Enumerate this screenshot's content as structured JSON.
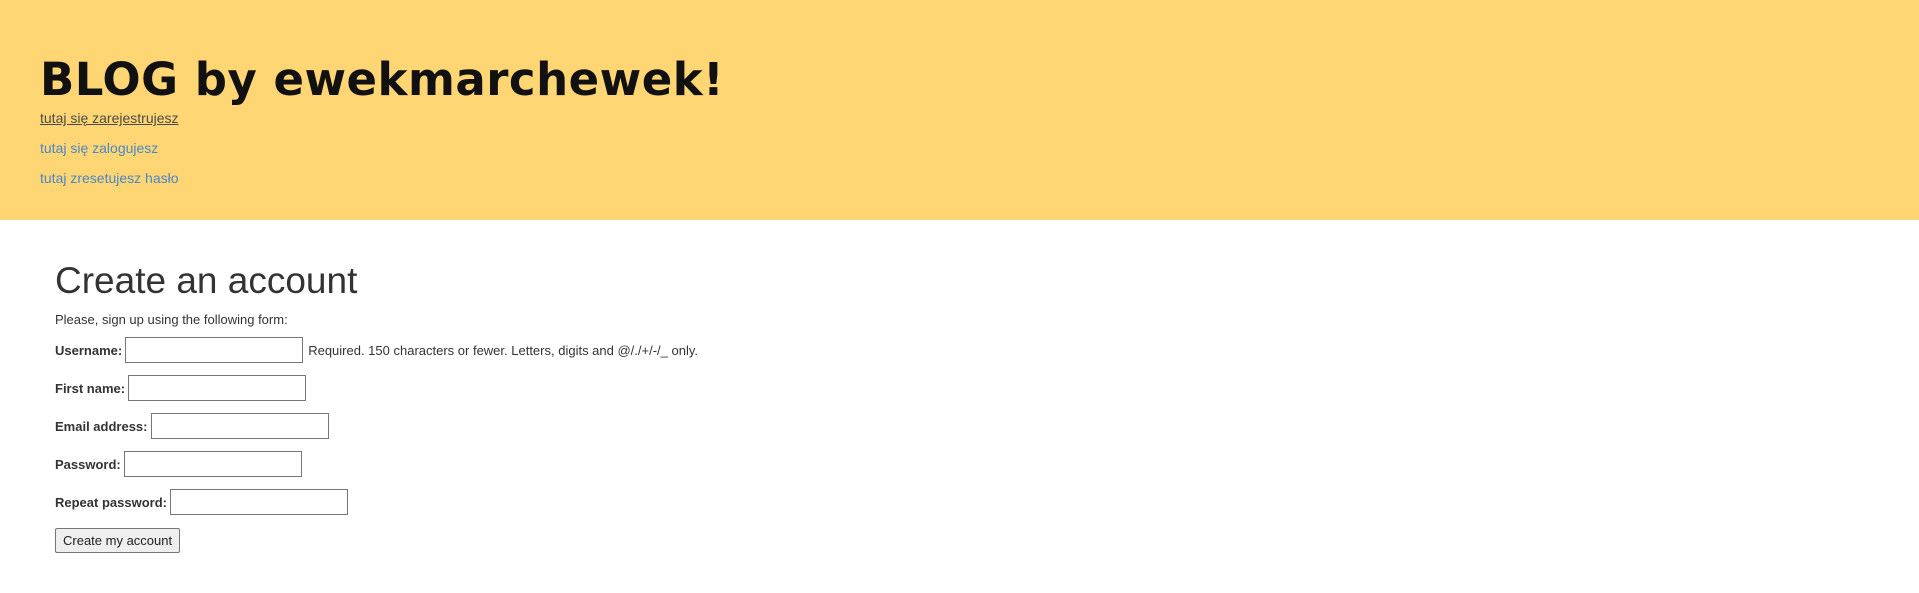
{
  "header": {
    "site_title": "BLOG by ewekmarchewek!",
    "nav": [
      {
        "label": "tutaj się zarejestrujesz"
      },
      {
        "label": "tutaj się zalogujesz"
      },
      {
        "label": "tutaj zresetujesz hasło"
      }
    ]
  },
  "form": {
    "title": "Create an account",
    "intro": "Please, sign up using the following form:",
    "fields": {
      "username": {
        "label": "Username:",
        "value": "",
        "help": "Required. 150 characters or fewer. Letters, digits and @/./+/-/_ only."
      },
      "first_name": {
        "label": "First name:",
        "value": ""
      },
      "email": {
        "label": "Email address:",
        "value": ""
      },
      "password": {
        "label": "Password:",
        "value": ""
      },
      "password2": {
        "label": "Repeat password:",
        "value": ""
      }
    },
    "submit_label": "Create my account"
  },
  "colors": {
    "header_bg": "#ffd673",
    "link": "#4a86c8",
    "text": "#333333"
  }
}
